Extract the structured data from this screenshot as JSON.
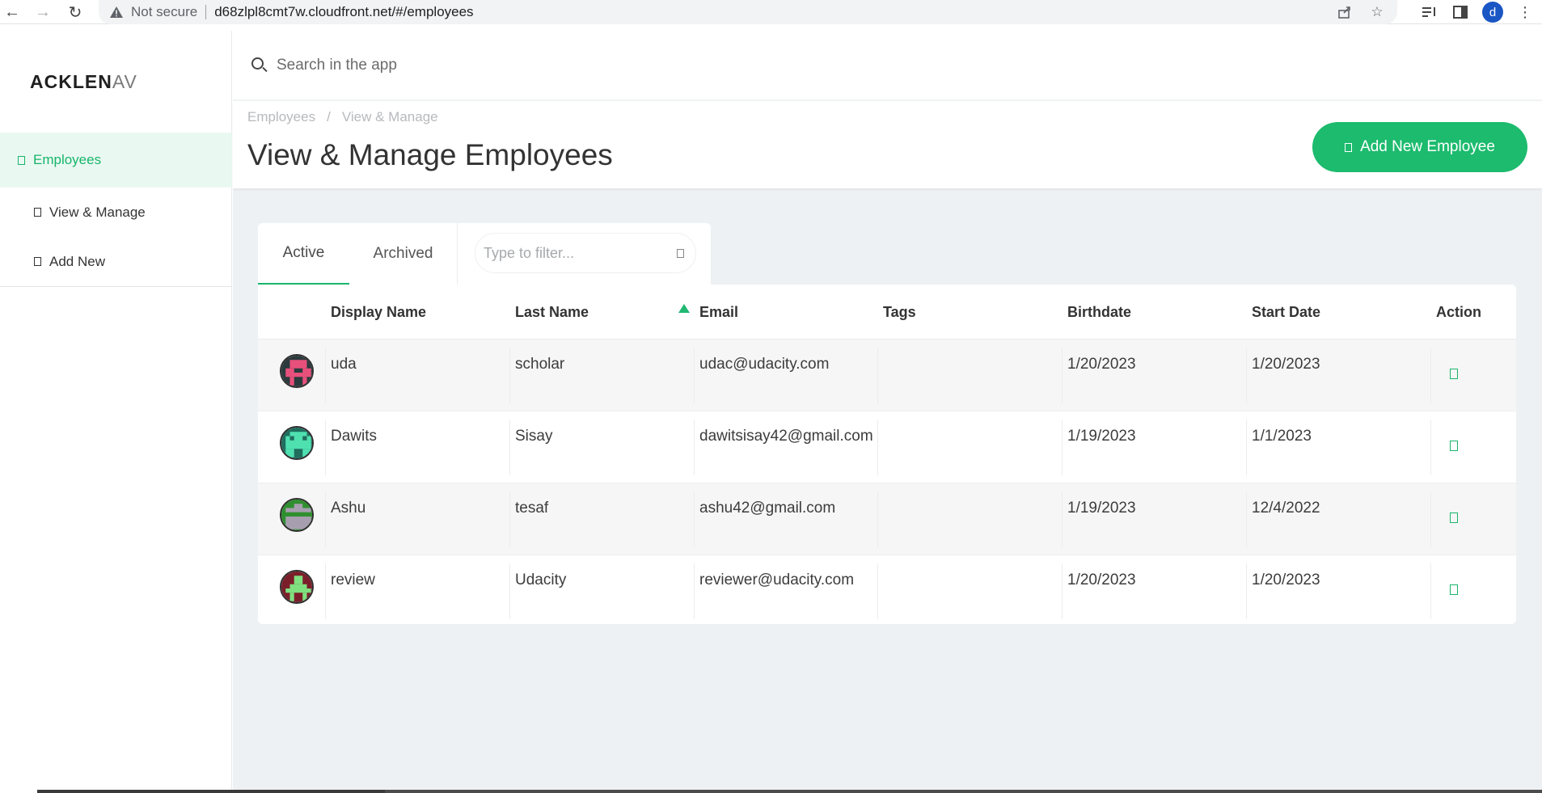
{
  "browser": {
    "security_label": "Not secure",
    "url": "d68zlpl8cmt7w.cloudfront.net/#/employees",
    "profile_initial": "d"
  },
  "sidebar": {
    "logo_main": "ACKLEN",
    "logo_tail": "AV",
    "items": [
      {
        "label": "Employees",
        "active": true
      },
      {
        "label": "View & Manage"
      },
      {
        "label": "Add New"
      }
    ]
  },
  "search": {
    "placeholder": "Search in the app"
  },
  "header": {
    "breadcrumb": [
      "Employees",
      "View & Manage"
    ],
    "breadcrumb_separator": "/",
    "title": "View & Manage Employees",
    "add_button_label": "Add New Employee"
  },
  "tabs": {
    "active_label": "Active",
    "archived_label": "Archived",
    "filter_placeholder": "Type to filter..."
  },
  "table": {
    "columns": [
      "Display Name",
      "Last Name",
      "Email",
      "Tags",
      "Birthdate",
      "Start Date",
      "Action"
    ],
    "sorted_column": "Last Name",
    "sort_direction": "ascending",
    "rows": [
      {
        "display_name": "uda",
        "last_name": "scholar",
        "email": "udac@udacity.com",
        "tags": "",
        "birthdate": "1/20/2023",
        "start_date": "1/20/2023",
        "avatar_colors": [
          "#2b3a3d",
          "#e8507c"
        ]
      },
      {
        "display_name": "Dawits",
        "last_name": "Sisay",
        "email": "dawitsisay42@gmail.com",
        "tags": "",
        "birthdate": "1/19/2023",
        "start_date": "1/1/2023",
        "avatar_colors": [
          "#1f6e5e",
          "#4fe0b0"
        ]
      },
      {
        "display_name": "Ashu",
        "last_name": "tesaf",
        "email": "ashu42@gmail.com",
        "tags": "",
        "birthdate": "1/19/2023",
        "start_date": "12/4/2022",
        "avatar_colors": [
          "#2f8f2f",
          "#a79fb0"
        ]
      },
      {
        "display_name": "review",
        "last_name": "Udacity",
        "email": "reviewer@udacity.com",
        "tags": "",
        "birthdate": "1/20/2023",
        "start_date": "1/20/2023",
        "avatar_colors": [
          "#7a1f2a",
          "#7fe07f"
        ]
      }
    ]
  },
  "colors": {
    "accent": "#1cbb6e",
    "sidebar_active_bg": "#eaf8f2",
    "main_bg": "#eef1f3"
  }
}
